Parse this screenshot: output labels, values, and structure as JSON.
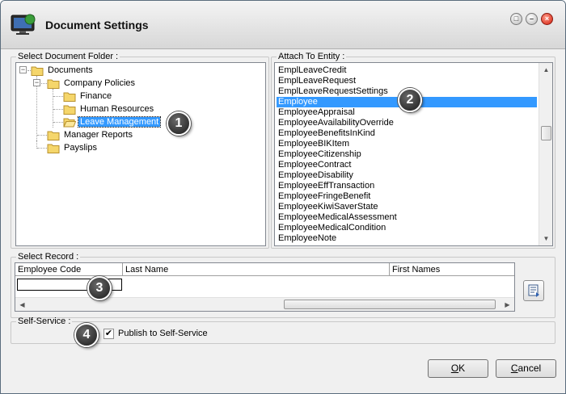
{
  "window": {
    "title": "Document Settings",
    "icon": "monitor-app-icon",
    "controls": [
      "restore",
      "minimize",
      "close"
    ]
  },
  "folder_group": {
    "label": "Select Document Folder :",
    "tree": {
      "root": "Documents",
      "company_policies": "Company Policies",
      "finance": "Finance",
      "human_resources": "Human Resources",
      "leave_management": "Leave Management",
      "manager_reports": "Manager Reports",
      "payslips": "Payslips"
    },
    "selected": "Leave Management"
  },
  "entity_group": {
    "label": "Attach To Entity :",
    "items": [
      "EmplLeaveCredit",
      "EmplLeaveRequest",
      "EmplLeaveRequestSettings",
      "Employee",
      "EmployeeAppraisal",
      "EmployeeAvailabilityOverride",
      "EmployeeBenefitsInKind",
      "EmployeeBIKItem",
      "EmployeeCitizenship",
      "EmployeeContract",
      "EmployeeDisability",
      "EmployeeEffTransaction",
      "EmployeeFringeBenefit",
      "EmployeeKiwiSaverState",
      "EmployeeMedicalAssessment",
      "EmployeeMedicalCondition",
      "EmployeeNote"
    ],
    "selected": "Employee"
  },
  "record_group": {
    "label": "Select Record :",
    "columns": [
      "Employee Code",
      "Last Name",
      "First Names"
    ]
  },
  "selfservice_group": {
    "label": "Self-Service :",
    "checkbox_label": "Publish to Self-Service",
    "checked": true
  },
  "buttons": {
    "ok": "OK",
    "ok_accel": "O",
    "ok_rest": "K",
    "cancel": "Cancel",
    "cancel_accel": "C",
    "cancel_rest": "ancel"
  },
  "callouts": [
    "1",
    "2",
    "3",
    "4"
  ],
  "colors": {
    "selection": "#3399ff",
    "callout": "#1a1a1a"
  }
}
